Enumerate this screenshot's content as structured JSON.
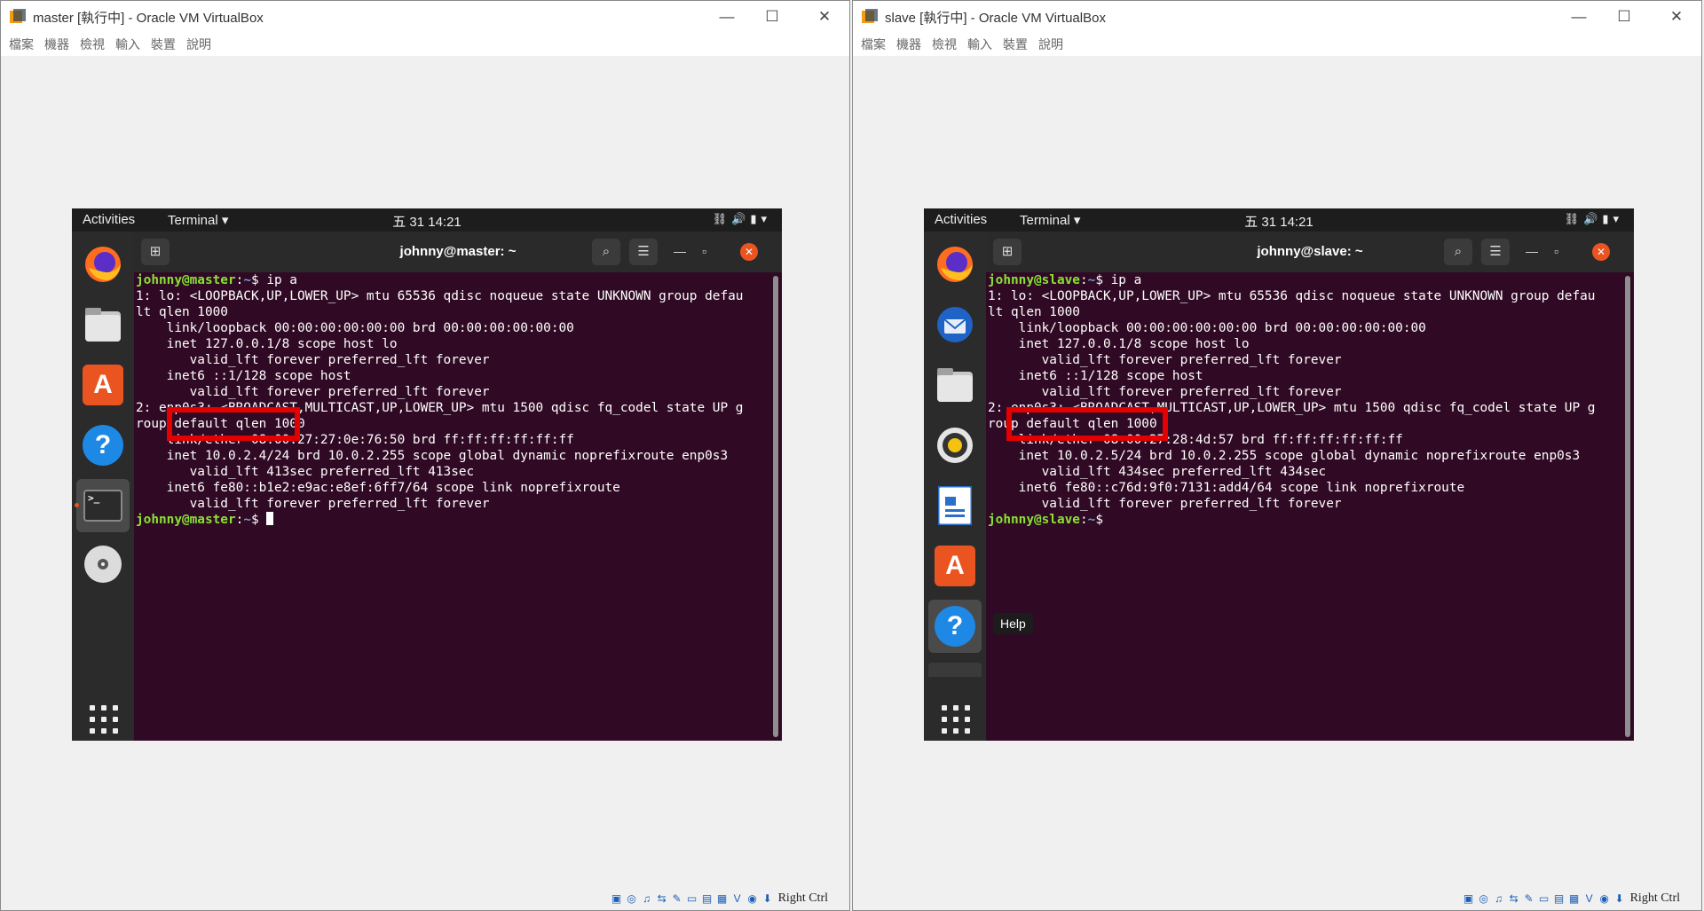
{
  "windows": [
    {
      "title": "master [執行中] - Oracle VM VirtualBox",
      "controls": {
        "minimize": "—",
        "maximize": "☐",
        "close": "✕"
      },
      "menu": [
        "檔案",
        "機器",
        "檢視",
        "輸入",
        "裝置",
        "說明"
      ],
      "topbar": {
        "activities": "Activities",
        "app_menu": "Terminal ▾",
        "clock": "五 31  14:21"
      },
      "terminal": {
        "title": "johnny@master: ~",
        "lines": [
          "1: lo: <LOOPBACK,UP,LOWER_UP> mtu 65536 qdisc noqueue state UNKNOWN group defau",
          "lt qlen 1000",
          "    link/loopback 00:00:00:00:00:00 brd 00:00:00:00:00:00",
          "    inet 127.0.0.1/8 scope host lo",
          "       valid_lft forever preferred_lft forever",
          "    inet6 ::1/128 scope host",
          "       valid_lft forever preferred_lft forever",
          "2: enp0s3: <BROADCAST,MULTICAST,UP,LOWER_UP> mtu 1500 qdisc fq_codel state UP g",
          "roup default qlen 1000",
          "    link/ether 08:00:27:27:0e:76:50 brd ff:ff:ff:ff:ff:ff",
          "    inet 10.0.2.4/24 brd 10.0.2.255 scope global dynamic noprefixroute enp0s3",
          "       valid_lft 413sec preferred_lft 413sec",
          "    inet6 fe80::b1e2:e9ac:e8ef:6ff7/64 scope link noprefixroute",
          "       valid_lft forever preferred_lft forever"
        ],
        "prompt_user": "johnny@master",
        "prompt_path": "~",
        "prompt_symbol": "$",
        "command": " ip a",
        "highlight": "inet 10.0.2.4/24"
      },
      "dock": [
        "firefox-icon",
        "files-icon",
        "software-icon",
        "help-icon",
        "terminal-icon",
        "disc-icon"
      ],
      "status_text": "Right Ctrl"
    },
    {
      "title": "slave [執行中] - Oracle VM VirtualBox",
      "controls": {
        "minimize": "—",
        "maximize": "☐",
        "close": "✕"
      },
      "menu": [
        "檔案",
        "機器",
        "檢視",
        "輸入",
        "裝置",
        "說明"
      ],
      "topbar": {
        "activities": "Activities",
        "app_menu": "Terminal ▾",
        "clock": "五 31  14:21"
      },
      "terminal": {
        "title": "johnny@slave: ~",
        "lines": [
          "1: lo: <LOOPBACK,UP,LOWER_UP> mtu 65536 qdisc noqueue state UNKNOWN group defau",
          "lt qlen 1000",
          "    link/loopback 00:00:00:00:00:00 brd 00:00:00:00:00:00",
          "    inet 127.0.0.1/8 scope host lo",
          "       valid_lft forever preferred_lft forever",
          "    inet6 ::1/128 scope host",
          "       valid_lft forever preferred_lft forever",
          "2: enp0s3: <BROADCAST,MULTICAST,UP,LOWER_UP> mtu 1500 qdisc fq_codel state UP g",
          "roup default qlen 1000",
          "    link/ether 08:00:27:28:4d:57 brd ff:ff:ff:ff:ff:ff",
          "    inet 10.0.2.5/24 brd 10.0.2.255 scope global dynamic noprefixroute enp0s3",
          "       valid_lft 434sec preferred_lft 434sec",
          "    inet6 fe80::c76d:9f0:7131:add4/64 scope link noprefixroute",
          "       valid_lft forever preferred_lft forever"
        ],
        "prompt_user": "johnny@slave",
        "prompt_path": "~",
        "prompt_symbol": "$",
        "command": " ip a",
        "highlight": "inet 10.0.2.5/24"
      },
      "dock": [
        "firefox-icon",
        "thunderbird-icon",
        "files-icon",
        "rhythmbox-icon",
        "libreoffice-writer-icon",
        "software-icon",
        "help-icon",
        "terminal-icon"
      ],
      "tooltip": "Help",
      "status_text": "Right Ctrl"
    }
  ],
  "colors": {
    "terminal_bg": "#300a24",
    "prompt_user": "#8ae234",
    "prompt_path": "#729fcf",
    "highlight_box": "#e30000",
    "ubuntu_orange": "#e95420"
  }
}
